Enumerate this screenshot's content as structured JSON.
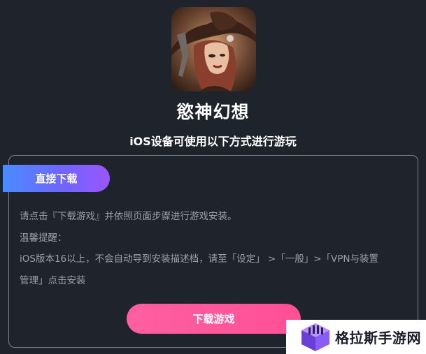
{
  "app": {
    "title": "慾神幻想",
    "subtitle": "iOS设备可使用以下方式进行游玩"
  },
  "panel": {
    "tab_label": "直接下载",
    "instructions": [
      "请点击『下载游戏』并依照页面步骤进行游戏安装。",
      "温馨提醒：",
      "iOS版本16以上，不会自动导到安装描述档，请至「设定」 >「一般」>「VPN与装置",
      "管理」点击安装"
    ],
    "download_label": "下载游戏"
  },
  "watermark": {
    "text": "格拉斯手游网"
  },
  "colors": {
    "background": "#1f232c",
    "tab_gradient_start": "#4a8bff",
    "tab_gradient_end": "#9b55ff",
    "download_button": "#ff5fa2",
    "instruction_text": "#9aa0ab"
  }
}
